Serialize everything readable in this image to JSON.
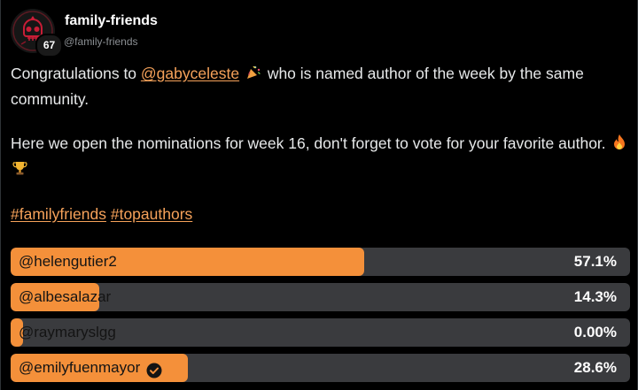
{
  "author": {
    "display_name": "family-friends",
    "handle": "@family-friends",
    "level": "67",
    "avatar_icon": "skull-icon"
  },
  "post": {
    "p1_before": "Congratulations to ",
    "p1_mention": "@gabyceleste",
    "p1_after": " who is named author of the week by the same community.",
    "p1_emoji": "party-popper-icon",
    "p2_text": "Here we open the nominations for week 16, don't forget to vote for your favorite author.",
    "p2_emojis": [
      "fire-icon",
      "trophy-icon"
    ],
    "hashtags": [
      "#familyfriends",
      "#topauthors"
    ]
  },
  "poll": {
    "options": [
      {
        "label": "@helengutier2",
        "percent_text": "57.1%",
        "fraction": 0.571,
        "verified": false
      },
      {
        "label": "@albesalazar",
        "percent_text": "14.3%",
        "fraction": 0.143,
        "verified": false
      },
      {
        "label": "@raymaryslgg",
        "percent_text": "0.00%",
        "fraction": 0.0,
        "verified": false
      },
      {
        "label": "@emilyfuenmayor",
        "percent_text": "28.6%",
        "fraction": 0.286,
        "verified": true
      }
    ]
  },
  "colors": {
    "accent": "#f4903a",
    "link": "#f6a25a",
    "bar_track": "#3a3b3e",
    "background": "#000000"
  }
}
